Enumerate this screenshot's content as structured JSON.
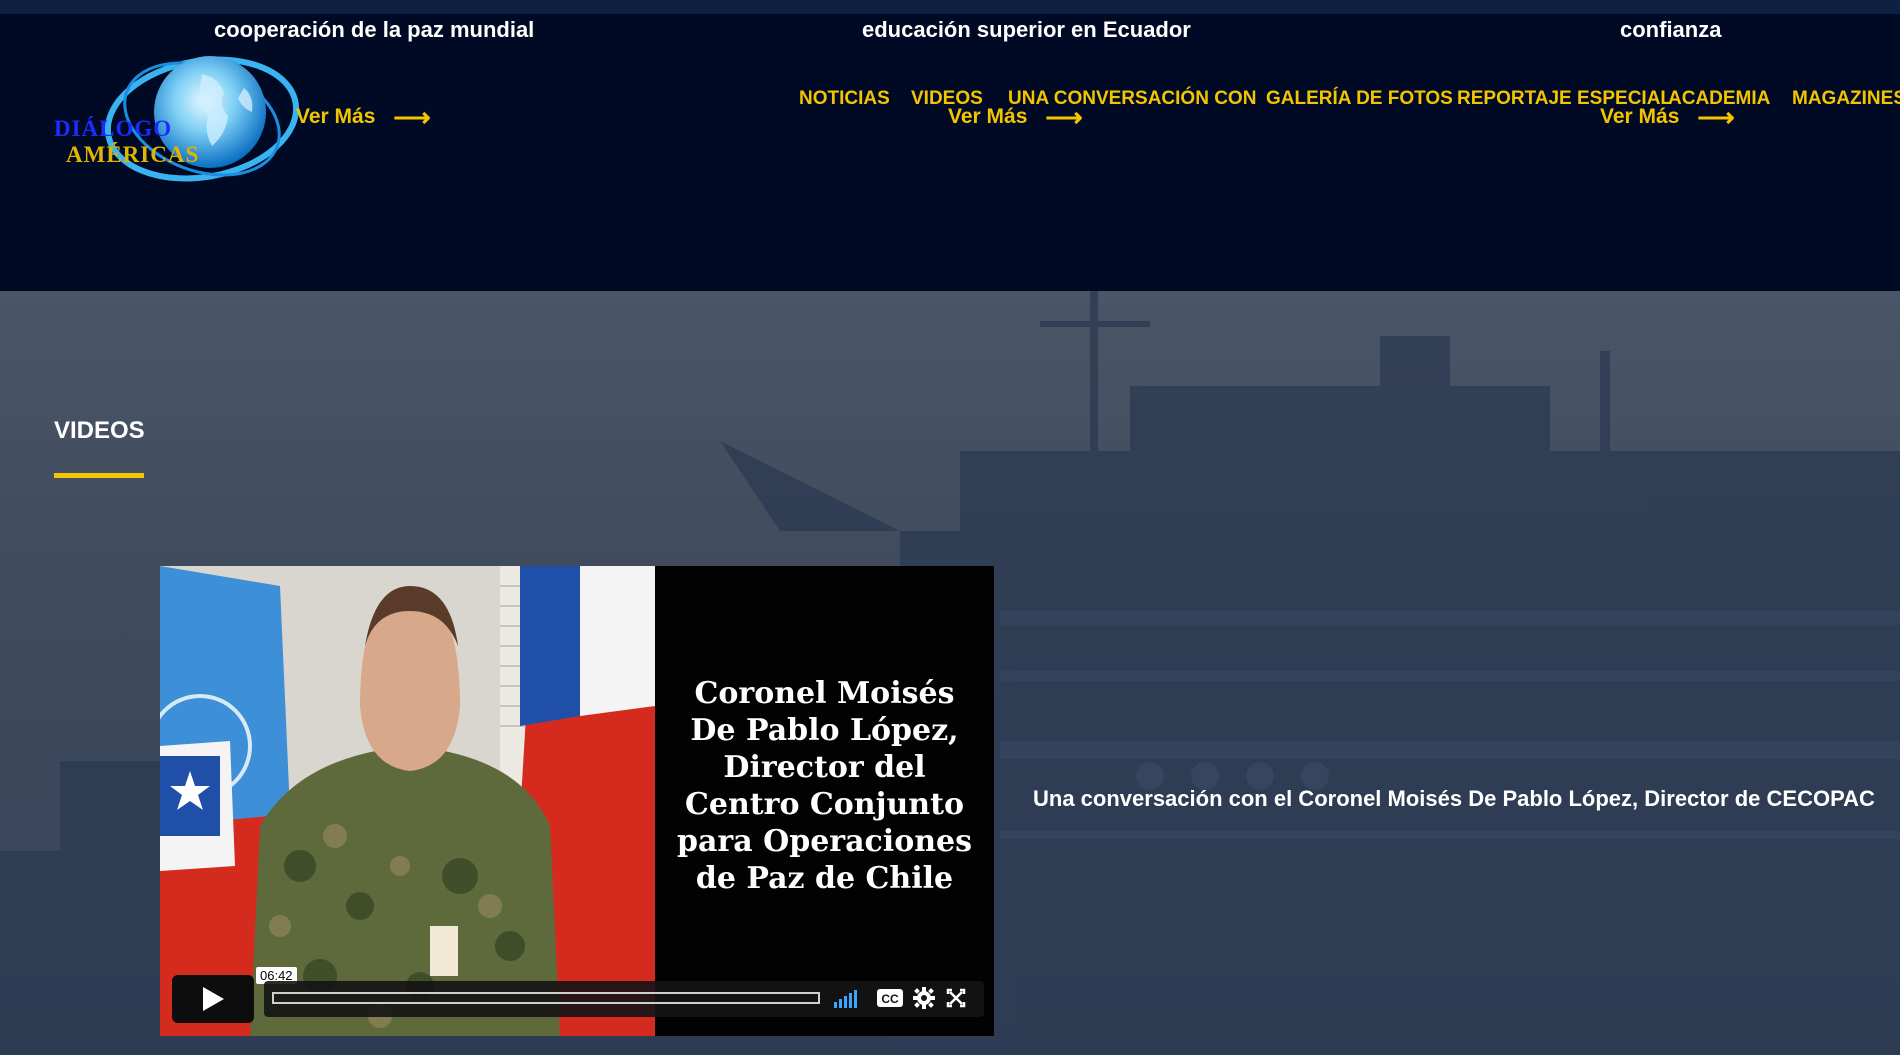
{
  "carousel": {
    "captions": [
      "cooperación de la paz mundial",
      "educación superior en Ecuador",
      "confianza"
    ],
    "ver_mas": "Ver Más"
  },
  "logo": {
    "line1": "DIÁLOGO",
    "line2": "AMÉRICAS"
  },
  "nav": {
    "items": [
      "NOTICIAS",
      "VIDEOS",
      "UNA CONVERSACIÓN CON",
      "GALERÍA DE FOTOS",
      "REPORTAJE ESPECIAL",
      "ACADEMIA",
      "MAGAZINES"
    ]
  },
  "section": {
    "title": "VIDEOS"
  },
  "video": {
    "title_card": "Coronel Moisés De Pablo López, Director del Centro Conjunto para Operaciones de Paz de Chile",
    "duration": "06:42",
    "progress": 0,
    "caption": "Una conversación con el Coronel Moisés De Pablo López, Director de CECOPAC"
  },
  "colors": {
    "accent": "#f3c400",
    "header_bg": "#000a24",
    "hero_bg": "#3f4b5d"
  },
  "icons": [
    "play-icon",
    "volume-icon",
    "cc-icon",
    "gear-icon",
    "fullscreen-icon",
    "arrow-right-icon",
    "globe-icon"
  ]
}
